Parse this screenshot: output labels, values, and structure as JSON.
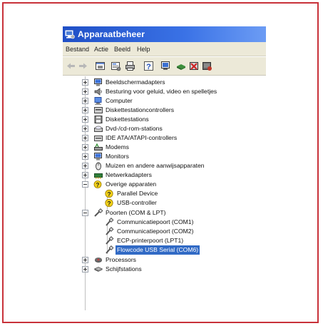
{
  "window": {
    "title": "Apparaatbeheer",
    "title_icon": "device-manager-icon"
  },
  "menubar": {
    "items": [
      "Bestand",
      "Actie",
      "Beeld",
      "Help"
    ]
  },
  "toolbar": {
    "buttons": [
      "back-arrow-icon",
      "forward-arrow-icon",
      "show-hide-tree-icon",
      "properties-icon",
      "print-icon",
      "help-icon",
      "scan-hardware-icon",
      "update-driver-icon",
      "uninstall-icon",
      "disable-icon"
    ]
  },
  "tree": {
    "items": [
      {
        "label": "Beeldschermadapters",
        "state": "collapsed",
        "icon": "display-icon"
      },
      {
        "label": "Besturing voor geluid, video en spelletjes",
        "state": "collapsed",
        "icon": "sound-icon"
      },
      {
        "label": "Computer",
        "state": "collapsed",
        "icon": "computer-icon"
      },
      {
        "label": "Diskettestationcontrollers",
        "state": "collapsed",
        "icon": "floppy-controller-icon"
      },
      {
        "label": "Diskettestations",
        "state": "collapsed",
        "icon": "floppy-drive-icon"
      },
      {
        "label": "Dvd-/cd-rom-stations",
        "state": "collapsed",
        "icon": "cdrom-icon"
      },
      {
        "label": "IDE ATA/ATAPI-controllers",
        "state": "collapsed",
        "icon": "ide-controller-icon"
      },
      {
        "label": "Modems",
        "state": "collapsed",
        "icon": "modem-icon"
      },
      {
        "label": "Monitors",
        "state": "collapsed",
        "icon": "monitor-icon"
      },
      {
        "label": "Muizen en andere aanwijsapparaten",
        "state": "collapsed",
        "icon": "mouse-icon"
      },
      {
        "label": "Netwerkadapters",
        "state": "collapsed",
        "icon": "network-adapter-icon"
      },
      {
        "label": "Overige apparaten",
        "state": "expanded",
        "icon": "unknown-device-icon"
      },
      {
        "label": "Parallel Device",
        "child": true,
        "icon": "question-device-icon"
      },
      {
        "label": "USB-controller",
        "child": true,
        "icon": "question-device-icon"
      },
      {
        "label": "Poorten (COM & LPT)",
        "state": "expanded",
        "icon": "port-icon"
      },
      {
        "label": "Communicatiepoort (COM1)",
        "child": true,
        "icon": "port-icon"
      },
      {
        "label": "Communicatiepoort (COM2)",
        "child": true,
        "icon": "port-icon"
      },
      {
        "label": "ECP-printerpoort (LPT1)",
        "child": true,
        "icon": "port-icon"
      },
      {
        "label": "Flowcode USB Serial (COM6)",
        "child": true,
        "selected": true,
        "icon": "port-icon"
      },
      {
        "label": "Processors",
        "state": "collapsed",
        "icon": "processor-icon"
      },
      {
        "label": "Schijfstations",
        "state": "collapsed",
        "icon": "disk-drive-icon"
      }
    ]
  }
}
